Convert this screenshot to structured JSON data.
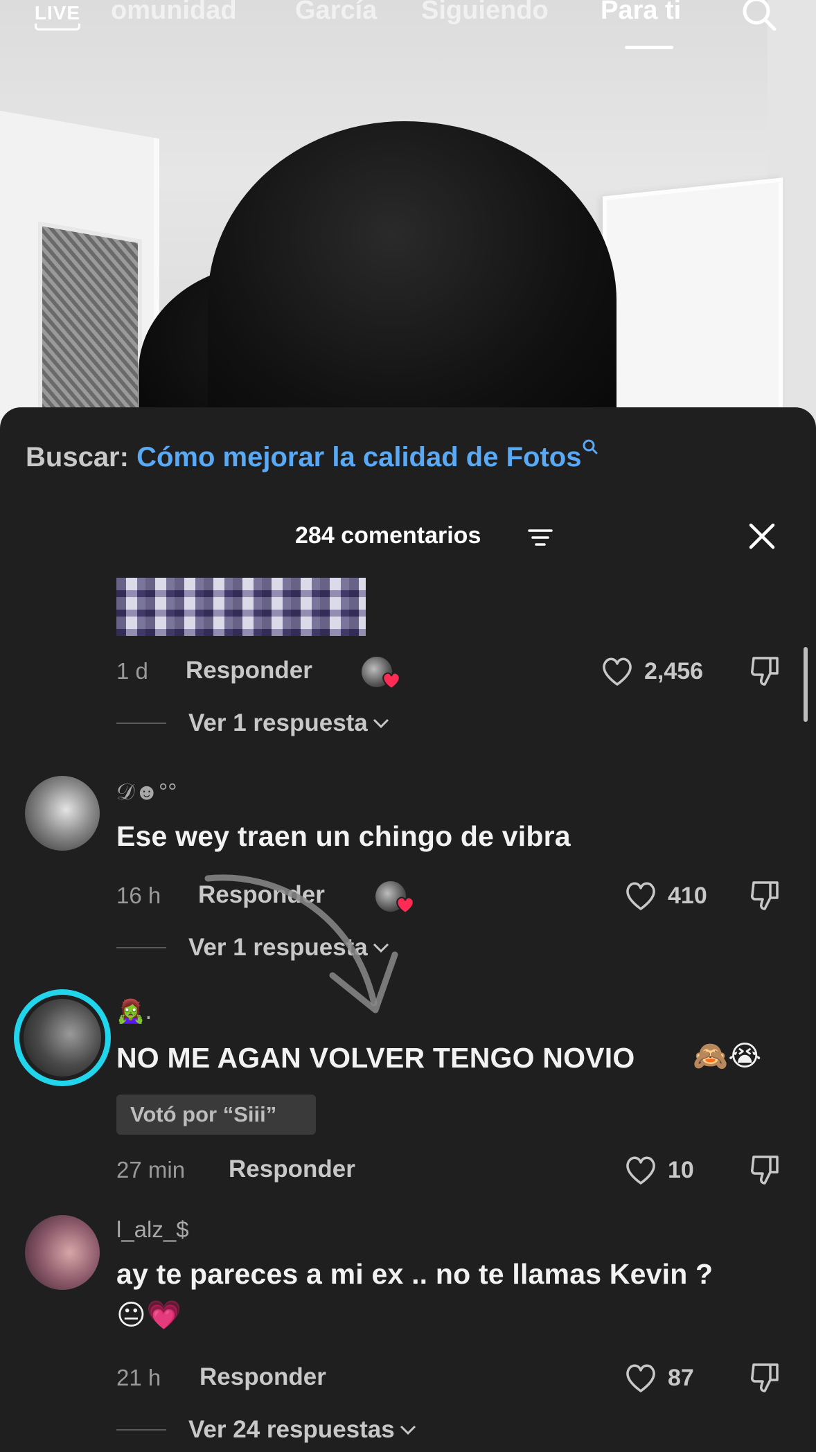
{
  "nav": {
    "live": "LIVE",
    "tabs": [
      "omunidad",
      "García",
      "Siguiendo",
      "Para ti"
    ],
    "active_tab": "Para ti"
  },
  "search_suggestion": {
    "label": "Buscar:",
    "query": "Cómo mejorar la calidad de Fotos"
  },
  "header": {
    "count_label": "284 comentarios"
  },
  "comments": [
    {
      "time": "1 d",
      "reply_label": "Responder",
      "likes": "2,456",
      "view_replies": "Ver 1 respuesta"
    },
    {
      "username": "𝒟☻°°",
      "text": "Ese wey traen un chingo de vibra",
      "time": "16 h",
      "reply_label": "Responder",
      "likes": "410",
      "view_replies": "Ver 1 respuesta"
    },
    {
      "username": "🧟‍♀️.",
      "text": "NO ME AGAN VOLVER TENGO NOVIO",
      "emojis": "🙈😭",
      "vote": "Votó por “Siii”",
      "time": "27 min",
      "reply_label": "Responder",
      "likes": "10"
    },
    {
      "username": "l_alz_$",
      "text": "ay te pareces a mi ex .. no te llamas Kevin ?",
      "emojis": "😐💗",
      "time": "21 h",
      "reply_label": "Responder",
      "likes": "87",
      "view_replies": "Ver 24 respuestas"
    }
  ],
  "colors": {
    "sheet_bg": "#1f1f1f",
    "search_query": "#5aa9f5",
    "liked_heart": "#fe2c55",
    "story_ring": "#20d5ec"
  }
}
